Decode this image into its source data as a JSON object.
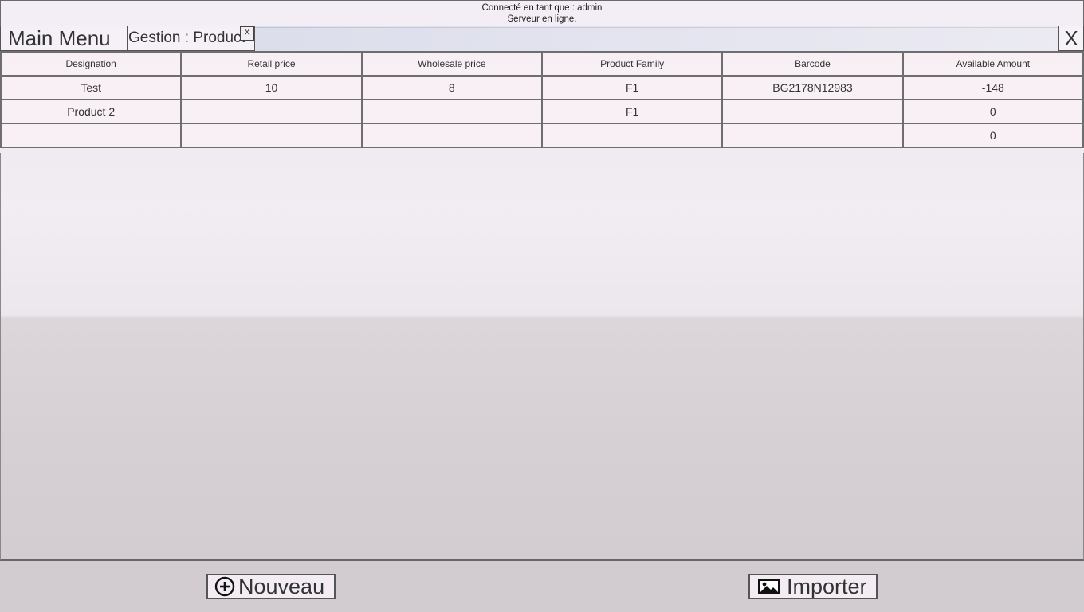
{
  "status": {
    "connected_as": "Connecté en tant que : admin",
    "server_status": "Serveur en ligne."
  },
  "tabs": {
    "main_menu": "Main Menu",
    "product_tab": "Gestion : Product",
    "product_tab_close": "X",
    "close_window": "X"
  },
  "table": {
    "headers": [
      "Designation",
      "Retail price",
      "Wholesale price",
      "Product Family",
      "Barcode",
      "Available Amount"
    ],
    "rows": [
      [
        "Test",
        "10",
        "8",
        "F1",
        "BG2178N12983",
        "-148"
      ],
      [
        "Product 2",
        "",
        "",
        "F1",
        "",
        "0"
      ],
      [
        "",
        "",
        "",
        "",
        "",
        "0"
      ]
    ]
  },
  "actions": {
    "new_label": "Nouveau",
    "new_icon": "plus-circle-icon",
    "import_label": "Importer",
    "import_icon": "image-icon"
  }
}
